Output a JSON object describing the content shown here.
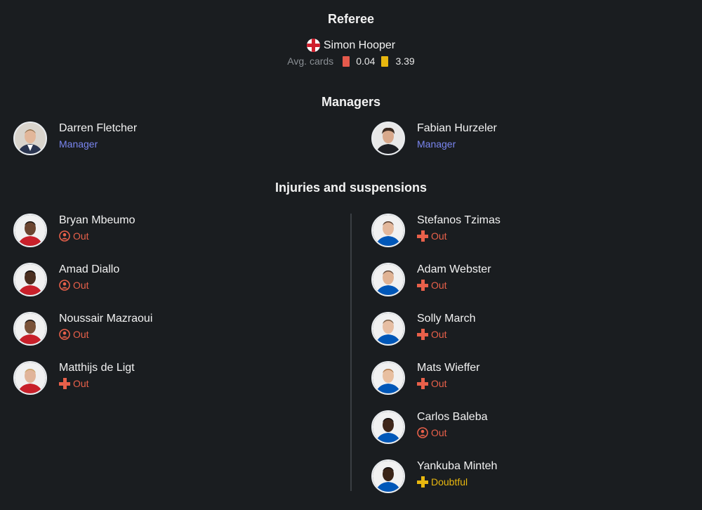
{
  "referee": {
    "title": "Referee",
    "name": "Simon Hooper",
    "flag": "england-flag-icon",
    "avg_cards_label": "Avg. cards",
    "red_cards_avg": "0.04",
    "yellow_cards_avg": "3.39",
    "colors": {
      "red_card": "#e55a4c",
      "yellow_card": "#e8b70f"
    }
  },
  "managers": {
    "title": "Managers",
    "home": {
      "name": "Darren Fletcher",
      "role": "Manager"
    },
    "away": {
      "name": "Fabian Hurzeler",
      "role": "Manager"
    }
  },
  "injuries": {
    "title": "Injuries and suspensions",
    "home": [
      {
        "name": "Bryan Mbeumo",
        "status": "Out",
        "icon": "suspended-icon"
      },
      {
        "name": "Amad Diallo",
        "status": "Out",
        "icon": "suspended-icon"
      },
      {
        "name": "Noussair Mazraoui",
        "status": "Out",
        "icon": "suspended-icon"
      },
      {
        "name": "Matthijs de Ligt",
        "status": "Out",
        "icon": "injury-cross-icon"
      }
    ],
    "away": [
      {
        "name": "Stefanos Tzimas",
        "status": "Out",
        "icon": "injury-cross-icon"
      },
      {
        "name": "Adam Webster",
        "status": "Out",
        "icon": "injury-cross-icon"
      },
      {
        "name": "Solly March",
        "status": "Out",
        "icon": "injury-cross-icon"
      },
      {
        "name": "Mats Wieffer",
        "status": "Out",
        "icon": "injury-cross-icon"
      },
      {
        "name": "Carlos Baleba",
        "status": "Out",
        "icon": "suspended-icon"
      },
      {
        "name": "Yankuba Minteh",
        "status": "Doubtful",
        "icon": "injury-cross-icon"
      }
    ]
  },
  "colors": {
    "background": "#1a1d20",
    "manager_role": "#7a86f0",
    "status_out": "#e8604a",
    "status_doubtful": "#e8b70f",
    "home_kit": "#c8202a",
    "away_kit": "#0057b8"
  }
}
